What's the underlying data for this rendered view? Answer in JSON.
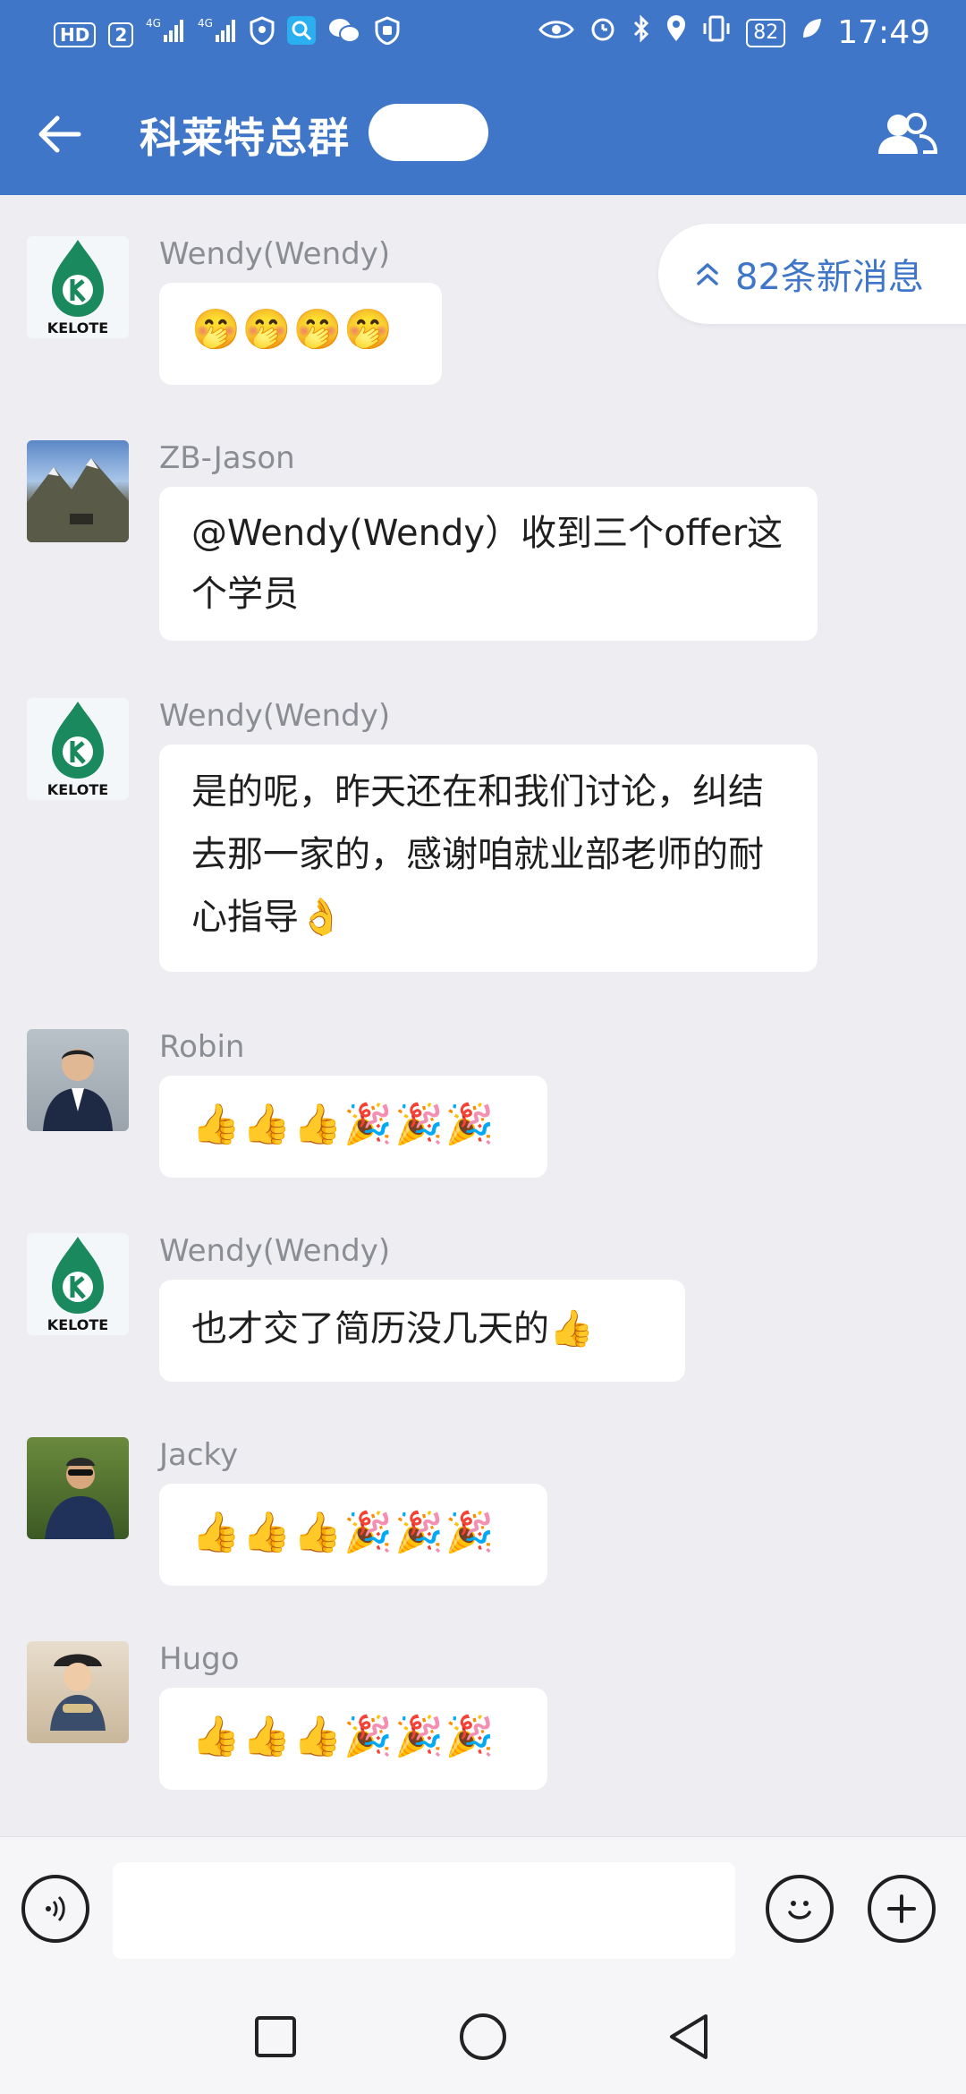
{
  "status_bar": {
    "left_chips": [
      "HD",
      "2"
    ],
    "signal_labels": [
      "4G",
      "4G"
    ],
    "battery": "82",
    "time": "17:49"
  },
  "header": {
    "title": "科莱特总群",
    "back_icon": "arrow-left-icon",
    "members_icon": "group-members-icon"
  },
  "new_messages": {
    "label": "82条新消息",
    "icon": "double-chevron-up-icon"
  },
  "messages": [
    {
      "sender": "Wendy(Wendy)",
      "avatar": "kelote-logo",
      "text": "🤭🤭🤭🤭"
    },
    {
      "sender": "ZB-Jason",
      "avatar": "mountain-photo",
      "text": "@Wendy(Wendy）收到三个offer这个学员"
    },
    {
      "sender": "Wendy(Wendy)",
      "avatar": "kelote-logo",
      "text": "是的呢，昨天还在和我们讨论，纠结去那一家的，感谢咱就业部老师的耐心指导👌"
    },
    {
      "sender": "Robin",
      "avatar": "portrait-photo",
      "text": "👍👍👍🎉🎉🎉"
    },
    {
      "sender": "Wendy(Wendy)",
      "avatar": "kelote-logo",
      "text": "也才交了简历没几天的👍"
    },
    {
      "sender": "Jacky",
      "avatar": "outdoor-photo",
      "text": "👍👍👍🎉🎉🎉"
    },
    {
      "sender": "Hugo",
      "avatar": "child-photo",
      "text": "👍👍👍🎉🎉🎉"
    }
  ],
  "logo_text": "KELOTE",
  "input_bar": {
    "voice_icon": "voice-input-icon",
    "emoji_icon": "emoji-icon",
    "plus_icon": "plus-icon",
    "placeholder": ""
  },
  "nav_bar": {
    "icons": [
      "recents-square-icon",
      "home-circle-icon",
      "back-triangle-icon"
    ]
  },
  "colors": {
    "header_bg": "#3f76c8",
    "chat_bg": "#ededf2",
    "bubble_bg": "#ffffff",
    "accent": "#3f76c8",
    "sender_name": "#8a8d93",
    "logo_green": "#1a8a5e"
  }
}
